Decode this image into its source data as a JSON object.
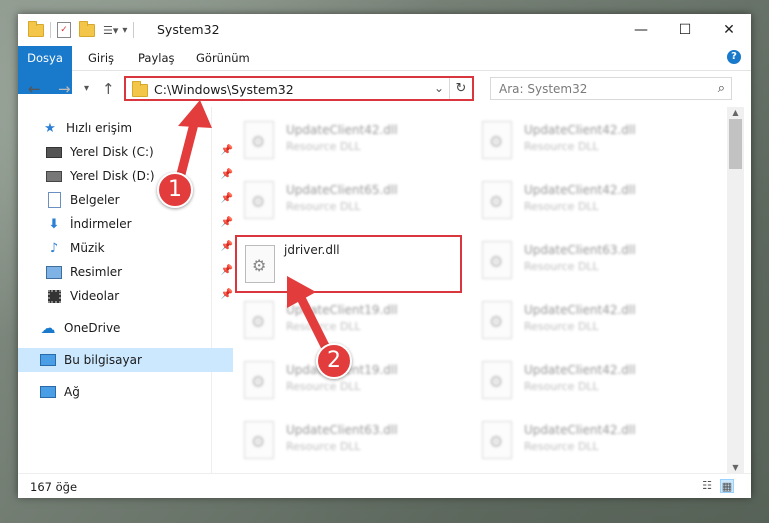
{
  "window": {
    "title": "System32",
    "minimize_glyph": "—",
    "maximize_glyph": "☐",
    "close_glyph": "✕"
  },
  "ribbon": {
    "file_tab": "Dosya",
    "tabs": [
      "Giriş",
      "Paylaş",
      "Görünüm"
    ],
    "help_glyph": "?"
  },
  "address": {
    "path": "C:\\Windows\\System32",
    "search_placeholder": "Ara: System32"
  },
  "nav": {
    "items": [
      {
        "label": "Hızlı erişim",
        "icon": "star-icon"
      },
      {
        "label": "Yerel Disk (C:)",
        "icon": "drive-icon"
      },
      {
        "label": "Yerel Disk (D:)",
        "icon": "drive-icon"
      },
      {
        "label": "Belgeler",
        "icon": "documents-icon"
      },
      {
        "label": "İndirmeler",
        "icon": "download-icon"
      },
      {
        "label": "Müzik",
        "icon": "music-icon"
      },
      {
        "label": "Resimler",
        "icon": "pictures-icon"
      },
      {
        "label": "Videolar",
        "icon": "videos-icon"
      },
      {
        "label": "OneDrive",
        "icon": "cloud-icon"
      },
      {
        "label": "Bu bilgisayar",
        "icon": "computer-icon"
      },
      {
        "label": "Ağ",
        "icon": "network-icon"
      }
    ]
  },
  "files": {
    "left": [
      {
        "name": "UpdateClient42.dll",
        "type": "Resource DLL"
      },
      {
        "name": "UpdateClient65.dll",
        "type": "Resource DLL"
      },
      {
        "name": "jdriver.dll",
        "type": ""
      },
      {
        "name": "UpdateClient19.dll",
        "type": "Resource DLL"
      },
      {
        "name": "UpdateClient19.dll",
        "type": "Resource DLL"
      },
      {
        "name": "UpdateClient63.dll",
        "type": "Resource DLL"
      }
    ],
    "right": [
      {
        "name": "UpdateClient42.dll",
        "type": "Resource DLL"
      },
      {
        "name": "UpdateClient42.dll",
        "type": "Resource DLL"
      },
      {
        "name": "UpdateClient63.dll",
        "type": "Resource DLL"
      },
      {
        "name": "UpdateClient42.dll",
        "type": "Resource DLL"
      },
      {
        "name": "UpdateClient42.dll",
        "type": "Resource DLL"
      },
      {
        "name": "UpdateClient42.dll",
        "type": "Resource DLL"
      }
    ]
  },
  "status": {
    "count": "167 öğe"
  },
  "annotations": {
    "badge1": "1",
    "badge2": "2",
    "color": "#e23c3c"
  }
}
